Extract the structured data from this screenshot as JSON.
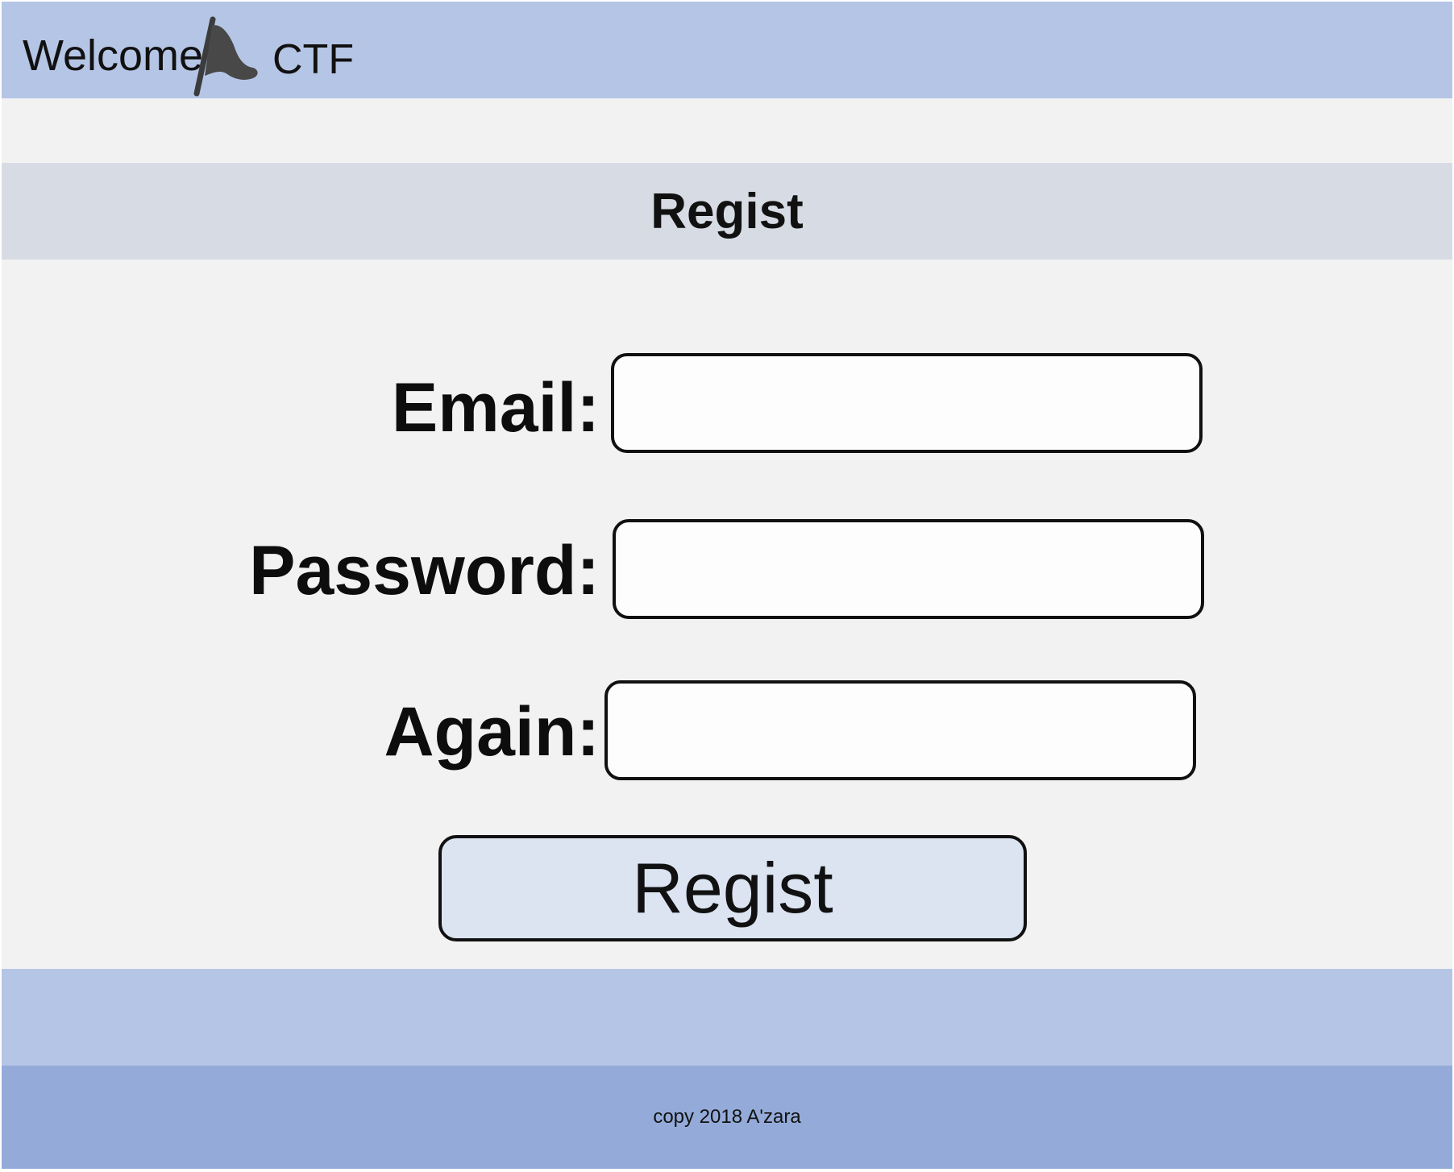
{
  "header": {
    "brand_left": "Welcome",
    "brand_right": "CTF",
    "logo_icon": "flag-icon"
  },
  "page": {
    "title": "Regist"
  },
  "form": {
    "email_label": "Email:",
    "email_value": "",
    "password_label": "Password:",
    "password_value": "",
    "again_label": "Again:",
    "again_value": "",
    "submit_label": "Regist"
  },
  "footer": {
    "copyright": "copy 2018 A'zara"
  },
  "colors": {
    "header_bg": "#b5c5e5",
    "title_bar_bg": "#d7dce4",
    "content_bg": "#f2f2f2",
    "footer_bg": "#94abd9",
    "button_bg": "#dce4f2"
  }
}
